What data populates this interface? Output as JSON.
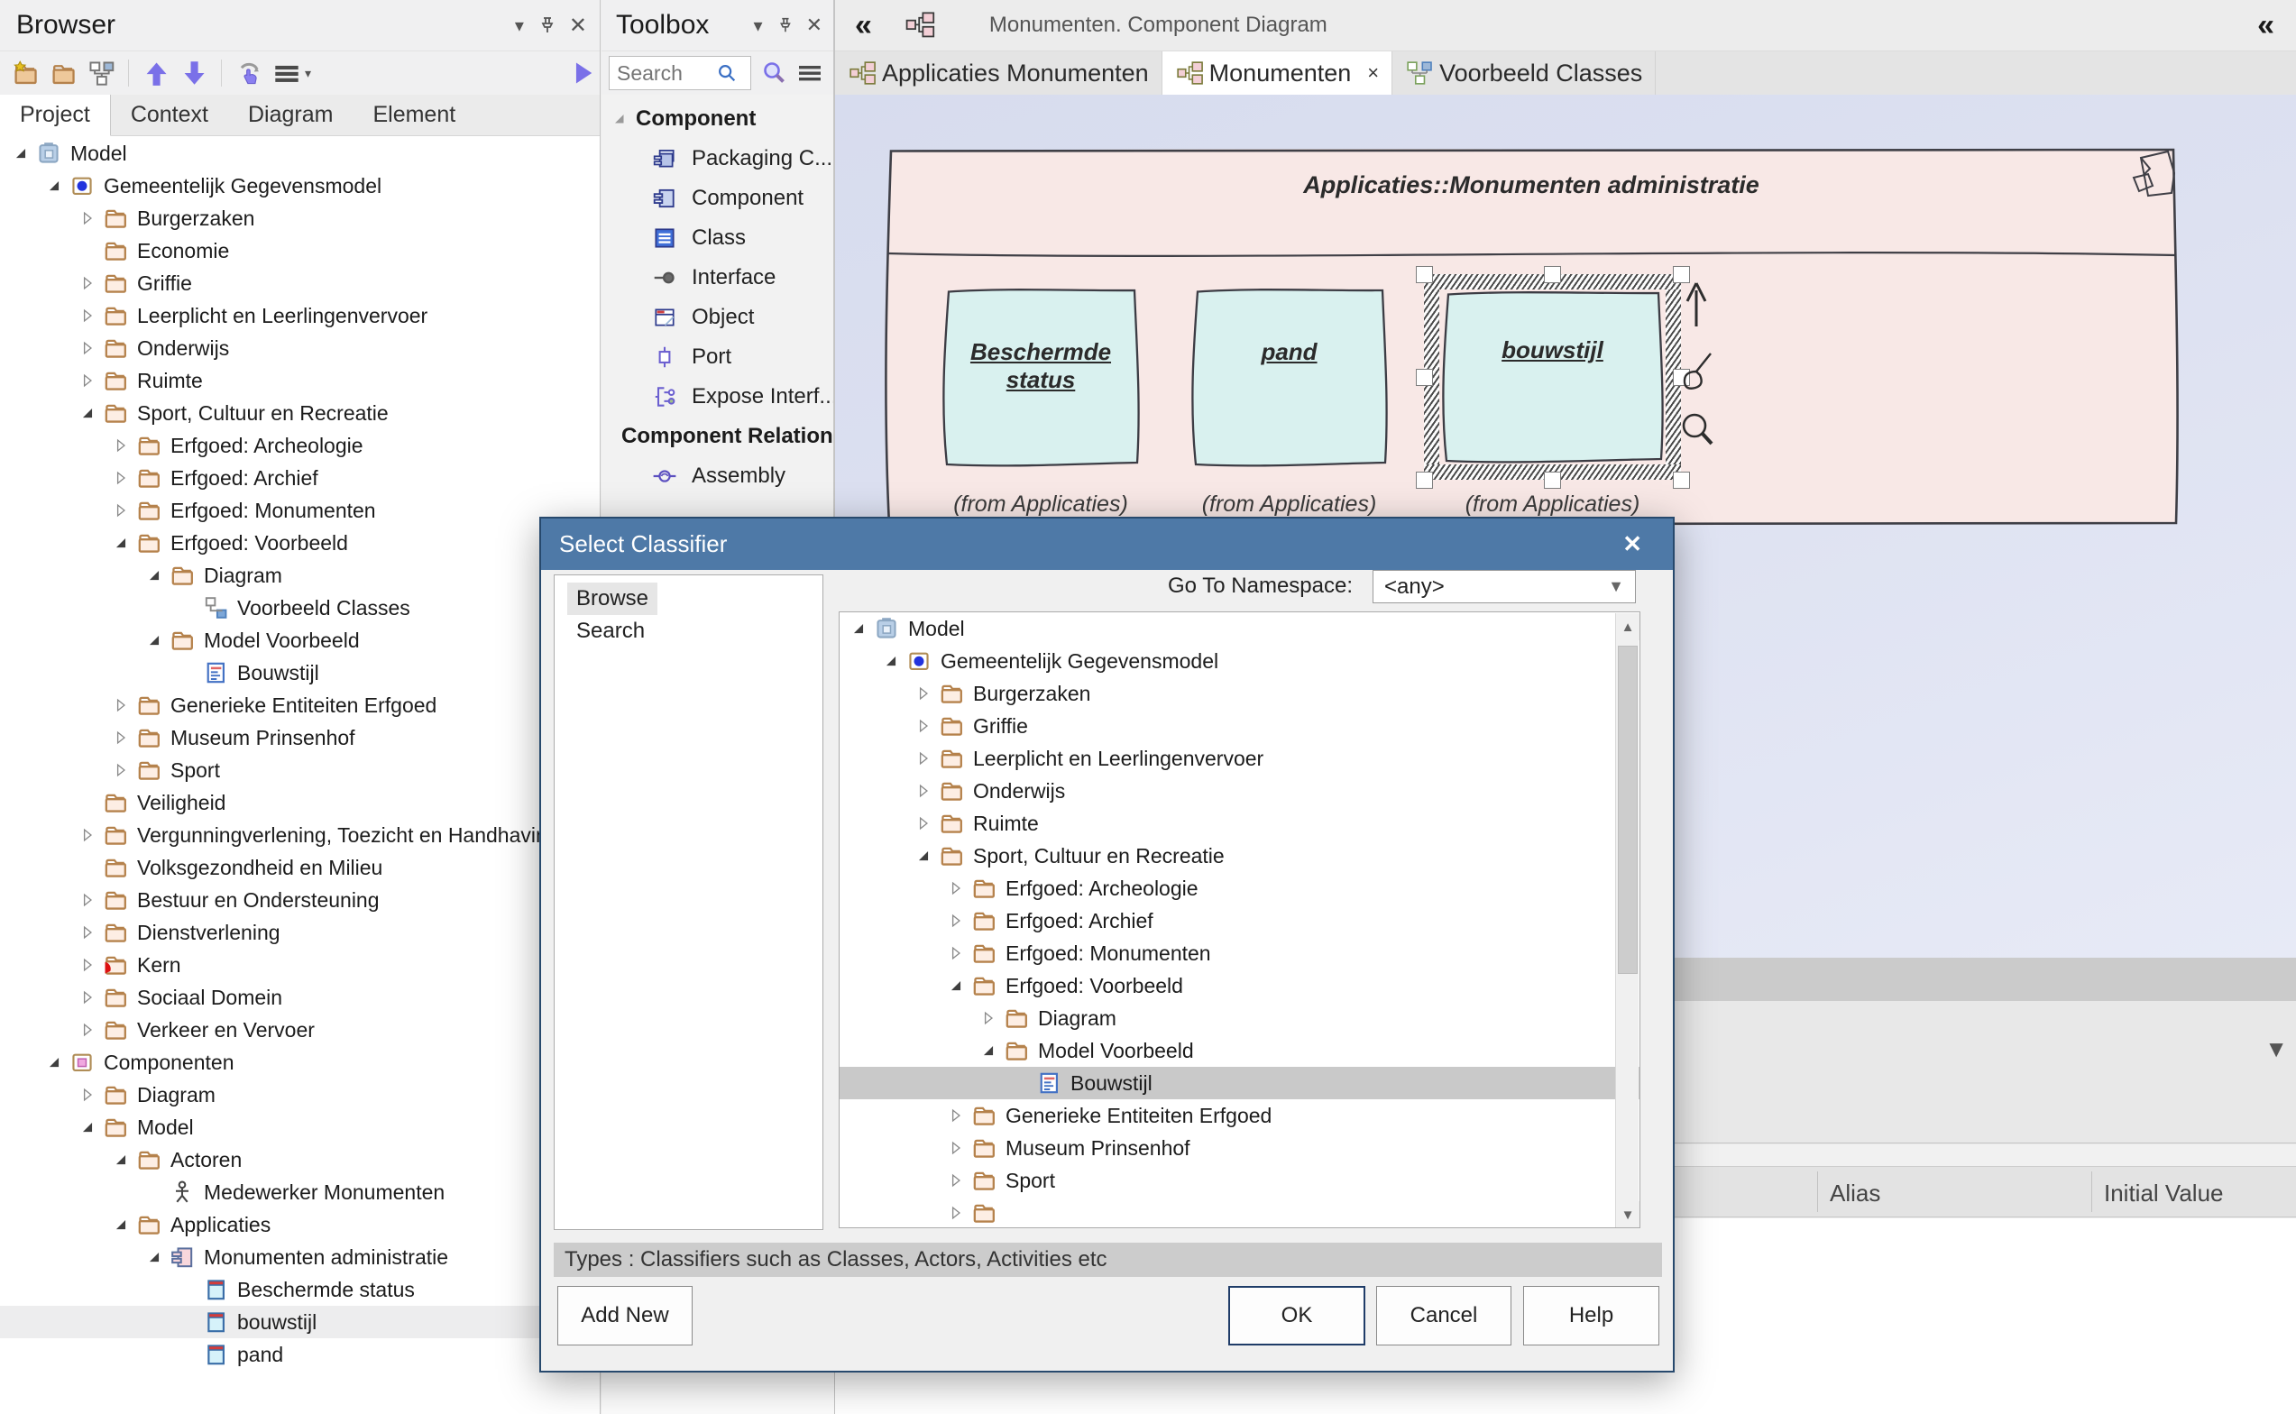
{
  "colors": {
    "dialog_titlebar": "#4e79a7",
    "dialog_border": "#27496d",
    "diagram_background": "#dde1f1",
    "container_fill": "#f8e8e6",
    "element_fill": "#d9f1ef",
    "sketch_stroke": "#3f3f46",
    "selected_row_dialog": "#c9c9c9",
    "selected_row_browser": "#ededee",
    "accent_blue": "#7a70e8"
  },
  "browser": {
    "title": "Browser",
    "window_icons": [
      "chevron-down",
      "pin",
      "close"
    ],
    "toolbar_icons": [
      "new-model",
      "folder",
      "model-tree",
      "sep",
      "arrow-up",
      "arrow-down",
      "sep",
      "locate",
      "menu",
      "menu-caret",
      "spacer",
      "play"
    ],
    "tabs": [
      "Project",
      "Context",
      "Diagram",
      "Element"
    ],
    "active_tab": "Project",
    "tree": [
      {
        "label": "Model",
        "level": 0,
        "state": "expanded",
        "icon": "model-root"
      },
      {
        "label": "Gemeentelijk Gegevensmodel",
        "level": 1,
        "state": "expanded",
        "icon": "model-view"
      },
      {
        "label": "Burgerzaken",
        "level": 2,
        "state": "collapsed",
        "icon": "folder"
      },
      {
        "label": "Economie",
        "level": 2,
        "state": "leaf",
        "icon": "folder"
      },
      {
        "label": "Griffie",
        "level": 2,
        "state": "collapsed",
        "icon": "folder"
      },
      {
        "label": "Leerplicht en Leerlingenvervoer",
        "level": 2,
        "state": "collapsed",
        "icon": "folder"
      },
      {
        "label": "Onderwijs",
        "level": 2,
        "state": "collapsed",
        "icon": "folder"
      },
      {
        "label": "Ruimte",
        "level": 2,
        "state": "collapsed",
        "icon": "folder"
      },
      {
        "label": "Sport, Cultuur en Recreatie",
        "level": 2,
        "state": "expanded",
        "icon": "folder"
      },
      {
        "label": "Erfgoed: Archeologie",
        "level": 3,
        "state": "collapsed",
        "icon": "folder"
      },
      {
        "label": "Erfgoed: Archief",
        "level": 3,
        "state": "collapsed",
        "icon": "folder"
      },
      {
        "label": "Erfgoed: Monumenten",
        "level": 3,
        "state": "collapsed",
        "icon": "folder"
      },
      {
        "label": "Erfgoed: Voorbeeld",
        "level": 3,
        "state": "expanded",
        "icon": "folder"
      },
      {
        "label": "Diagram",
        "level": 4,
        "state": "expanded",
        "icon": "folder"
      },
      {
        "label": "Voorbeeld Classes",
        "level": 5,
        "state": "leaf",
        "icon": "diagram"
      },
      {
        "label": "Model Voorbeeld",
        "level": 4,
        "state": "expanded",
        "icon": "folder"
      },
      {
        "label": "Bouwstijl",
        "level": 5,
        "state": "leaf",
        "icon": "class-table"
      },
      {
        "label": "Generieke Entiteiten Erfgoed",
        "level": 3,
        "state": "collapsed",
        "icon": "folder"
      },
      {
        "label": "Museum Prinsenhof",
        "level": 3,
        "state": "collapsed",
        "icon": "folder"
      },
      {
        "label": "Sport",
        "level": 3,
        "state": "collapsed",
        "icon": "folder"
      },
      {
        "label": "Veiligheid",
        "level": 2,
        "state": "leaf",
        "icon": "folder"
      },
      {
        "label": "Vergunningverlening, Toezicht en Handhaving",
        "level": 2,
        "state": "collapsed",
        "icon": "folder"
      },
      {
        "label": "Volksgezondheid en Milieu",
        "level": 2,
        "state": "leaf",
        "icon": "folder"
      },
      {
        "label": "Bestuur en Ondersteuning",
        "level": 2,
        "state": "collapsed",
        "icon": "folder"
      },
      {
        "label": "Dienstverlening",
        "level": 2,
        "state": "collapsed",
        "icon": "folder"
      },
      {
        "label": "Kern",
        "level": 2,
        "state": "collapsed",
        "icon": "folder-red"
      },
      {
        "label": "Sociaal Domein",
        "level": 2,
        "state": "collapsed",
        "icon": "folder"
      },
      {
        "label": "Verkeer en Vervoer",
        "level": 2,
        "state": "collapsed",
        "icon": "folder"
      },
      {
        "label": "Componenten",
        "level": 1,
        "state": "expanded",
        "icon": "pkg-components"
      },
      {
        "label": "Diagram",
        "level": 2,
        "state": "collapsed",
        "icon": "folder"
      },
      {
        "label": "Model",
        "level": 2,
        "state": "expanded",
        "icon": "folder"
      },
      {
        "label": "Actoren",
        "level": 3,
        "state": "expanded",
        "icon": "folder"
      },
      {
        "label": "Medewerker Monumenten",
        "level": 4,
        "state": "leaf",
        "icon": "actor"
      },
      {
        "label": "Applicaties",
        "level": 3,
        "state": "expanded",
        "icon": "folder"
      },
      {
        "label": "Monumenten administratie",
        "level": 4,
        "state": "expanded",
        "icon": "component-pink"
      },
      {
        "label": "Beschermde status",
        "level": 5,
        "state": "leaf",
        "icon": "class-cyan"
      },
      {
        "label": "bouwstijl",
        "level": 5,
        "state": "leaf",
        "icon": "class-cyan",
        "selected": true
      },
      {
        "label": "pand",
        "level": 5,
        "state": "leaf",
        "icon": "class-cyan"
      }
    ]
  },
  "toolbox": {
    "title": "Toolbox",
    "window_icons": [
      "chevron-down",
      "pin",
      "close"
    ],
    "search_placeholder": "Search",
    "header_icons": [
      "search-blue",
      "search-purple",
      "menu"
    ],
    "groups": [
      {
        "label": "Component",
        "items": [
          {
            "icon": "packaging",
            "label": "Packaging C..."
          },
          {
            "icon": "component",
            "label": "Component"
          },
          {
            "icon": "class",
            "label": "Class"
          },
          {
            "icon": "interface",
            "label": "Interface"
          },
          {
            "icon": "object",
            "label": "Object"
          },
          {
            "icon": "port",
            "label": "Port"
          },
          {
            "icon": "expose",
            "label": "Expose Interf..."
          }
        ]
      },
      {
        "label": "Component Relations",
        "items": [
          {
            "icon": "assembly",
            "label": "Assembly"
          }
        ]
      }
    ]
  },
  "main": {
    "caption": {
      "collapse_left": "«",
      "title": "Monumenten.  Component Diagram",
      "collapse_right": "«"
    },
    "tabs": [
      {
        "label": "Applicaties Monumenten",
        "icon": "component-diagram",
        "active": false,
        "closable": false
      },
      {
        "label": "Monumenten",
        "icon": "component-diagram",
        "active": true,
        "closable": true
      },
      {
        "label": "Voorbeeld Classes",
        "icon": "class-diagram",
        "active": false,
        "closable": false
      }
    ],
    "close_glyph": "×"
  },
  "diagram": {
    "container_title": "Applicaties::Monumenten administratie",
    "elements": [
      {
        "name": "Beschermde status",
        "origin": "(from Applicaties)",
        "selected": false
      },
      {
        "name": "pand",
        "origin": "(from Applicaties)",
        "selected": false
      },
      {
        "name": "bouwstijl",
        "origin": "(from Applicaties)",
        "selected": true
      }
    ],
    "floating_tools": [
      "move-up-arrow",
      "brush",
      "magnifier"
    ]
  },
  "properties_panel": {
    "columns": [
      "Alias",
      "Initial Value"
    ]
  },
  "dialog": {
    "title": "Select Classifier",
    "close_glyph": "×",
    "nav": [
      {
        "label": "Browse",
        "selected": true
      },
      {
        "label": "Search",
        "selected": false
      }
    ],
    "namespace_label": "Go To Namespace:",
    "namespace_value": "<any>",
    "tree": [
      {
        "label": "Model",
        "level": 0,
        "state": "expanded",
        "icon": "model-root"
      },
      {
        "label": "Gemeentelijk Gegevensmodel",
        "level": 1,
        "state": "expanded",
        "icon": "model-view"
      },
      {
        "label": "Burgerzaken",
        "level": 2,
        "state": "collapsed",
        "icon": "folder"
      },
      {
        "label": "Griffie",
        "level": 2,
        "state": "collapsed",
        "icon": "folder"
      },
      {
        "label": "Leerplicht en Leerlingenvervoer",
        "level": 2,
        "state": "collapsed",
        "icon": "folder"
      },
      {
        "label": "Onderwijs",
        "level": 2,
        "state": "collapsed",
        "icon": "folder"
      },
      {
        "label": "Ruimte",
        "level": 2,
        "state": "collapsed",
        "icon": "folder"
      },
      {
        "label": "Sport, Cultuur en Recreatie",
        "level": 2,
        "state": "expanded",
        "icon": "folder"
      },
      {
        "label": "Erfgoed: Archeologie",
        "level": 3,
        "state": "collapsed",
        "icon": "folder"
      },
      {
        "label": "Erfgoed: Archief",
        "level": 3,
        "state": "collapsed",
        "icon": "folder"
      },
      {
        "label": "Erfgoed: Monumenten",
        "level": 3,
        "state": "collapsed",
        "icon": "folder"
      },
      {
        "label": "Erfgoed: Voorbeeld",
        "level": 3,
        "state": "expanded",
        "icon": "folder"
      },
      {
        "label": "Diagram",
        "level": 4,
        "state": "collapsed",
        "icon": "folder"
      },
      {
        "label": "Model Voorbeeld",
        "level": 4,
        "state": "expanded",
        "icon": "folder"
      },
      {
        "label": "Bouwstijl",
        "level": 5,
        "state": "leaf",
        "icon": "class-table",
        "selected": true
      },
      {
        "label": "Generieke Entiteiten Erfgoed",
        "level": 3,
        "state": "collapsed",
        "icon": "folder"
      },
      {
        "label": "Museum Prinsenhof",
        "level": 3,
        "state": "collapsed",
        "icon": "folder"
      },
      {
        "label": "Sport",
        "level": 3,
        "state": "collapsed",
        "icon": "folder"
      },
      {
        "label": "",
        "level": 3,
        "state": "collapsed",
        "icon": "folder",
        "partial": true
      }
    ],
    "types_text": "Types : Classifiers such as Classes, Actors, Activities etc",
    "buttons": {
      "add_new": "Add New",
      "ok": "OK",
      "cancel": "Cancel",
      "help": "Help"
    }
  }
}
